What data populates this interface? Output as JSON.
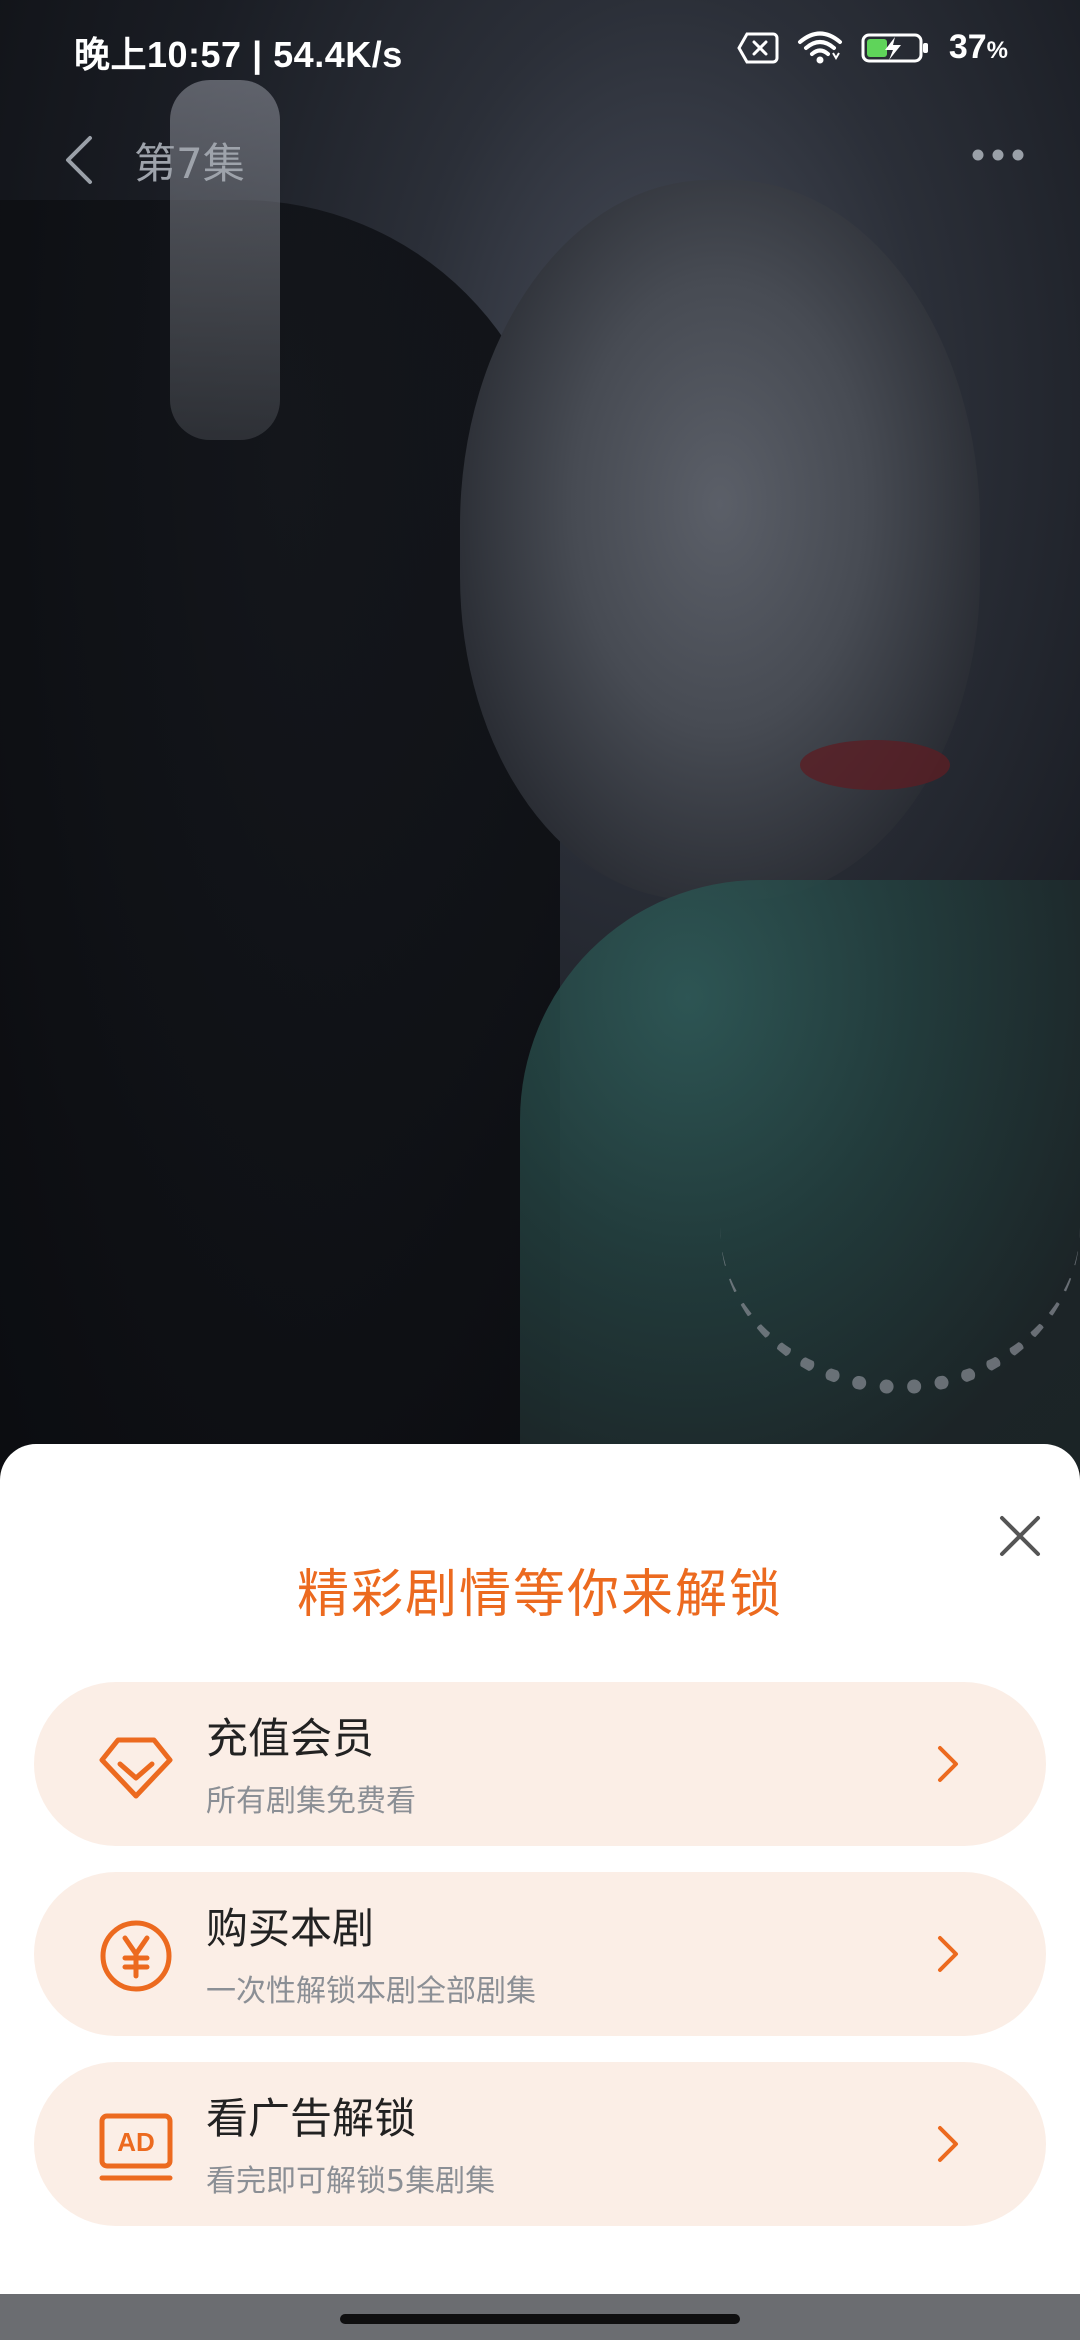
{
  "status_bar": {
    "time_and_speed": "晚上10:57 | 54.4K/s",
    "battery_percent": "37",
    "battery_unit": "%"
  },
  "top_nav": {
    "episode_title": "第7集"
  },
  "unlock_sheet": {
    "headline": "精彩剧情等你来解锁",
    "options": [
      {
        "title": "充值会员",
        "subtitle": "所有剧集免费看",
        "icon": "diamond-icon"
      },
      {
        "title": "购买本剧",
        "subtitle": "一次性解锁本剧全部剧集",
        "icon": "yuan-coin-icon"
      },
      {
        "title": "看广告解锁",
        "subtitle": "看完即可解锁5集剧集",
        "icon": "ad-icon"
      }
    ],
    "accent_color": "#ec6a1f",
    "option_bg_color": "#fbeee6"
  }
}
